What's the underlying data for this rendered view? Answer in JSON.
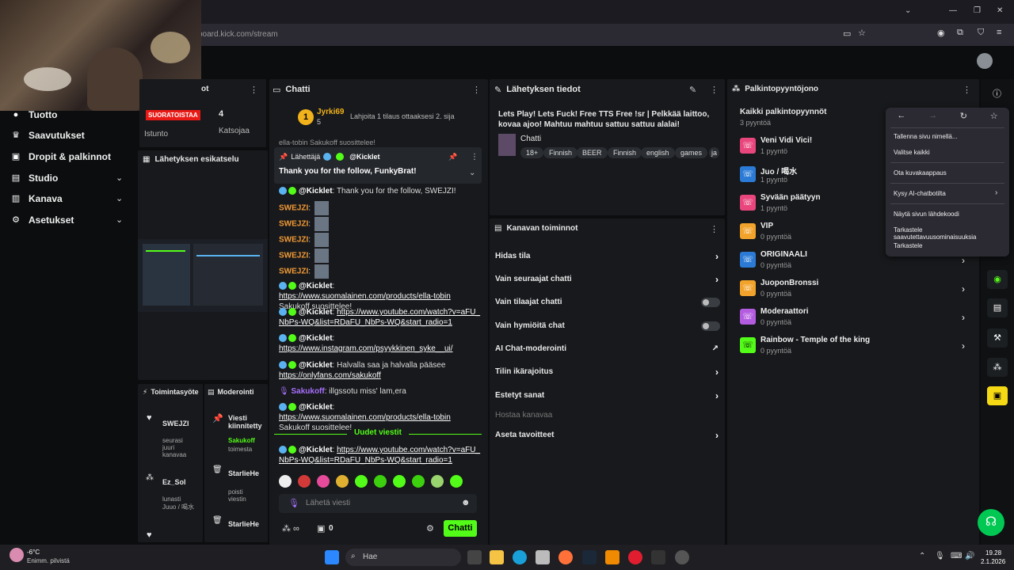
{
  "browser": {
    "url": "board.kick.com/stream",
    "controls": {
      "minimize": "—",
      "restore": "❐",
      "close": "✕"
    }
  },
  "sidebar": {
    "items": [
      {
        "label": "Tuotto",
        "icon": "coin-icon"
      },
      {
        "label": "Saavutukset",
        "icon": "trophy-icon"
      },
      {
        "label": "Dropit & palkinnot",
        "icon": "gift-icon"
      },
      {
        "label": "Studio",
        "icon": "studio-icon"
      },
      {
        "label": "Kanava",
        "icon": "channel-icon"
      },
      {
        "label": "Asetukset",
        "icon": "gear-icon"
      }
    ]
  },
  "stats": {
    "header_suffix": "ot",
    "live": "SUORATOISTAA",
    "session_label": "Istunto",
    "viewers_value": "4",
    "viewers_label": "Katsojaa"
  },
  "preview": {
    "title": "Lähetyksen esikatselu"
  },
  "activity": {
    "title": "Toimintasyöte",
    "items": [
      {
        "user": "SWEJZI",
        "text": "seurasi juuri kanavaa"
      },
      {
        "user": "Ez_Sol",
        "text": "lunasti Juuo / 喝水"
      }
    ]
  },
  "moderation": {
    "title": "Moderointi",
    "items": [
      {
        "title": "Viesti kiinnitetty",
        "user": "Sakukoff",
        "text": "toimesta"
      },
      {
        "title": "StarlieHe",
        "text": "poisti viestin"
      },
      {
        "title": "StarlieHe",
        "text": ""
      }
    ]
  },
  "chat": {
    "title": "Chatti",
    "gifter_name": "Jyrki69",
    "gifter_count": "5",
    "gift_text": "Lahjoita 1 tilaus ottaaksesi 2. sija",
    "pinned_label": "Lähettäjä",
    "pinned_user": "@Kicklet",
    "pinned_text": "Thank you for the follow, FunkyBrat!",
    "cut_top": "ella-tobin Sakukoff suosittelee!",
    "messages": [
      {
        "user": "@Kicklet",
        "text": "Thank you for the follow, SWEJZI!"
      },
      {
        "user": "SWEJZI",
        "text": ""
      },
      {
        "user": "SWEJZI",
        "text": ""
      },
      {
        "user": "SWEJZI",
        "text": ""
      },
      {
        "user": "SWEJZI",
        "text": ""
      },
      {
        "user": "SWEJZI",
        "text": ""
      },
      {
        "user": "@Kicklet",
        "link": "https://www.suomalainen.com/products/ella-tobin",
        "text": "Sakukoff suosittelee!"
      },
      {
        "user": "@Kicklet",
        "link": "https://www.youtube.com/watch?v=aFU_NbPs-WQ&list=RDaFU_NbPs-WQ&start_radio=1",
        "text": ""
      },
      {
        "user": "@Kicklet",
        "link": "https://www.instagram.com/psyykkinen_syke__ui/",
        "text": ""
      },
      {
        "user": "@Kicklet",
        "text": "Halvalla saa ja halvalla pääsee",
        "link": "https://onlyfans.com/sakukoff"
      },
      {
        "user": "Sakukoff",
        "text": "illgssotu miss' lam,era"
      },
      {
        "user": "@Kicklet",
        "link": "https://www.suomalainen.com/products/ella-tobin",
        "text": "Sakukoff suosittelee!"
      },
      {
        "user": "@Kicklet",
        "link": "https://www.youtube.com/watch?v=aFU_NbPs-WQ&list=RDaFU_NbPs-WQ&start_radio=1",
        "text": ""
      }
    ],
    "new_messages": "Uudet viestit",
    "input_placeholder": "Lähetä viesti",
    "points": "0",
    "send_label": "Chatti"
  },
  "stream_info": {
    "title": "Lähetyksen tiedot",
    "stream_title": "Lets Play! Lets Fuck! Free TTS Free !sr | Pelkkää laittoo, kovaa ajoo! Mahtuu mahtuu sattuu sattuu alalai!",
    "category": "Chatti",
    "tags": [
      "18+",
      "Finnish",
      "BEER",
      "Finnish",
      "english",
      "games",
      "ja"
    ]
  },
  "channel_actions": {
    "title": "Kanavan toiminnot",
    "items": [
      {
        "label": "Hidas tila",
        "control": "arrow"
      },
      {
        "label": "Vain seuraajat chatti",
        "control": "arrow"
      },
      {
        "label": "Vain tilaajat chatti",
        "control": "toggle"
      },
      {
        "label": "Vain hymiöitä chat",
        "control": "toggle"
      },
      {
        "label": "AI Chat-moderointi",
        "control": "external"
      },
      {
        "label": "Tilin ikärajoitus",
        "control": "arrow"
      },
      {
        "label": "Estetyt sanat",
        "control": "arrow"
      },
      {
        "label": "Hostaa kanavaa",
        "control": "none"
      },
      {
        "label": "Aseta tavoitteet",
        "control": "arrow"
      }
    ]
  },
  "rewards": {
    "title": "Palkintopyyntöjono",
    "subtitle": "Kaikki palkintopyynnöt",
    "count": "3 pyyntöä",
    "items": [
      {
        "name": "Veni Vidi Vici!",
        "sub": "1 pyyntö",
        "color": "#e8467c"
      },
      {
        "name": "Juo / 喝水",
        "sub": "1 pyyntö",
        "color": "#2b7bd6"
      },
      {
        "name": "Syvään päätyyn",
        "sub": "1 pyyntö",
        "color": "#e8467c"
      },
      {
        "name": "VIP",
        "sub": "0 pyyntöä",
        "color": "#f2a32b"
      },
      {
        "name": "ORIGINAALI",
        "sub": "0 pyyntöä",
        "color": "#2b7bd6"
      },
      {
        "name": "JuoponBronssi",
        "sub": "0 pyyntöä",
        "color": "#f2a32b"
      },
      {
        "name": "Moderaattori",
        "sub": "0 pyyntöä",
        "color": "#b45ce0"
      },
      {
        "name": "Rainbow - Temple of the king",
        "sub": "0 pyyntöä",
        "color": "#53fc18"
      }
    ]
  },
  "context_menu": {
    "items": [
      "Tallenna sivu nimellä...",
      "Valitse kaikki",
      "Ota kuvakaappaus",
      "Kysy AI-chatbotilta",
      "Näytä sivun lähdekoodi",
      "Tarkastele saavutettavuusominaisuuksia",
      "Tarkastele"
    ]
  },
  "taskbar": {
    "weather_temp": "-6°C",
    "weather_desc": "Enimm. pilvistä",
    "search": "Hae",
    "time": "19.28",
    "date": "2.1.2026"
  },
  "colors": {
    "accent": "#53fc18",
    "live": "#e91916",
    "panel": "#17191c"
  }
}
